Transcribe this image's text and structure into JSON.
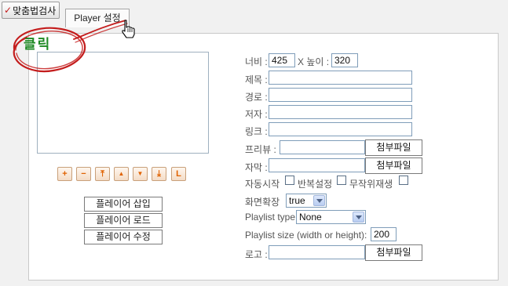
{
  "toolbar": {
    "spellcheck_label": "맞춤법검사",
    "player_tab_label": "Player 설정"
  },
  "callout": {
    "text": "클릭",
    "color": "#c41d1d"
  },
  "controls": [
    {
      "name": "zoom-in-button",
      "symbol": "+"
    },
    {
      "name": "zoom-out-button",
      "symbol": "−"
    },
    {
      "name": "move-top-button",
      "symbol": "⤒"
    },
    {
      "name": "move-up-button",
      "symbol": "▲"
    },
    {
      "name": "move-down-button",
      "symbol": "▼"
    },
    {
      "name": "move-bottom-button",
      "symbol": "⤓"
    },
    {
      "name": "large-button",
      "symbol": "L"
    }
  ],
  "actions": {
    "insert": "플레이어 삽입",
    "load": "플레이어 로드",
    "edit": "플레이어 수정"
  },
  "form": {
    "width_label": "너비 :",
    "width_value": "425",
    "x_height_label": "X 높이 :",
    "height_value": "320",
    "title_label": "제목 :",
    "path_label": "경로 :",
    "author_label": "저자 :",
    "link_label": "링크 :",
    "preview_label": "프리뷰 :",
    "subtitle_label": "자막 :",
    "attach_label": "첨부파일",
    "autoplay_label": "자동시작",
    "repeat_label": "반복설정",
    "shuffle_label": "무작위재생",
    "fullscreen_label": "화면확장",
    "fullscreen_value": "true",
    "playlist_type_label": "Playlist type",
    "playlist_type_value": "None",
    "playlist_size_label": "Playlist size (width or height):",
    "playlist_size_value": "200",
    "logo_label": "로고 :"
  }
}
